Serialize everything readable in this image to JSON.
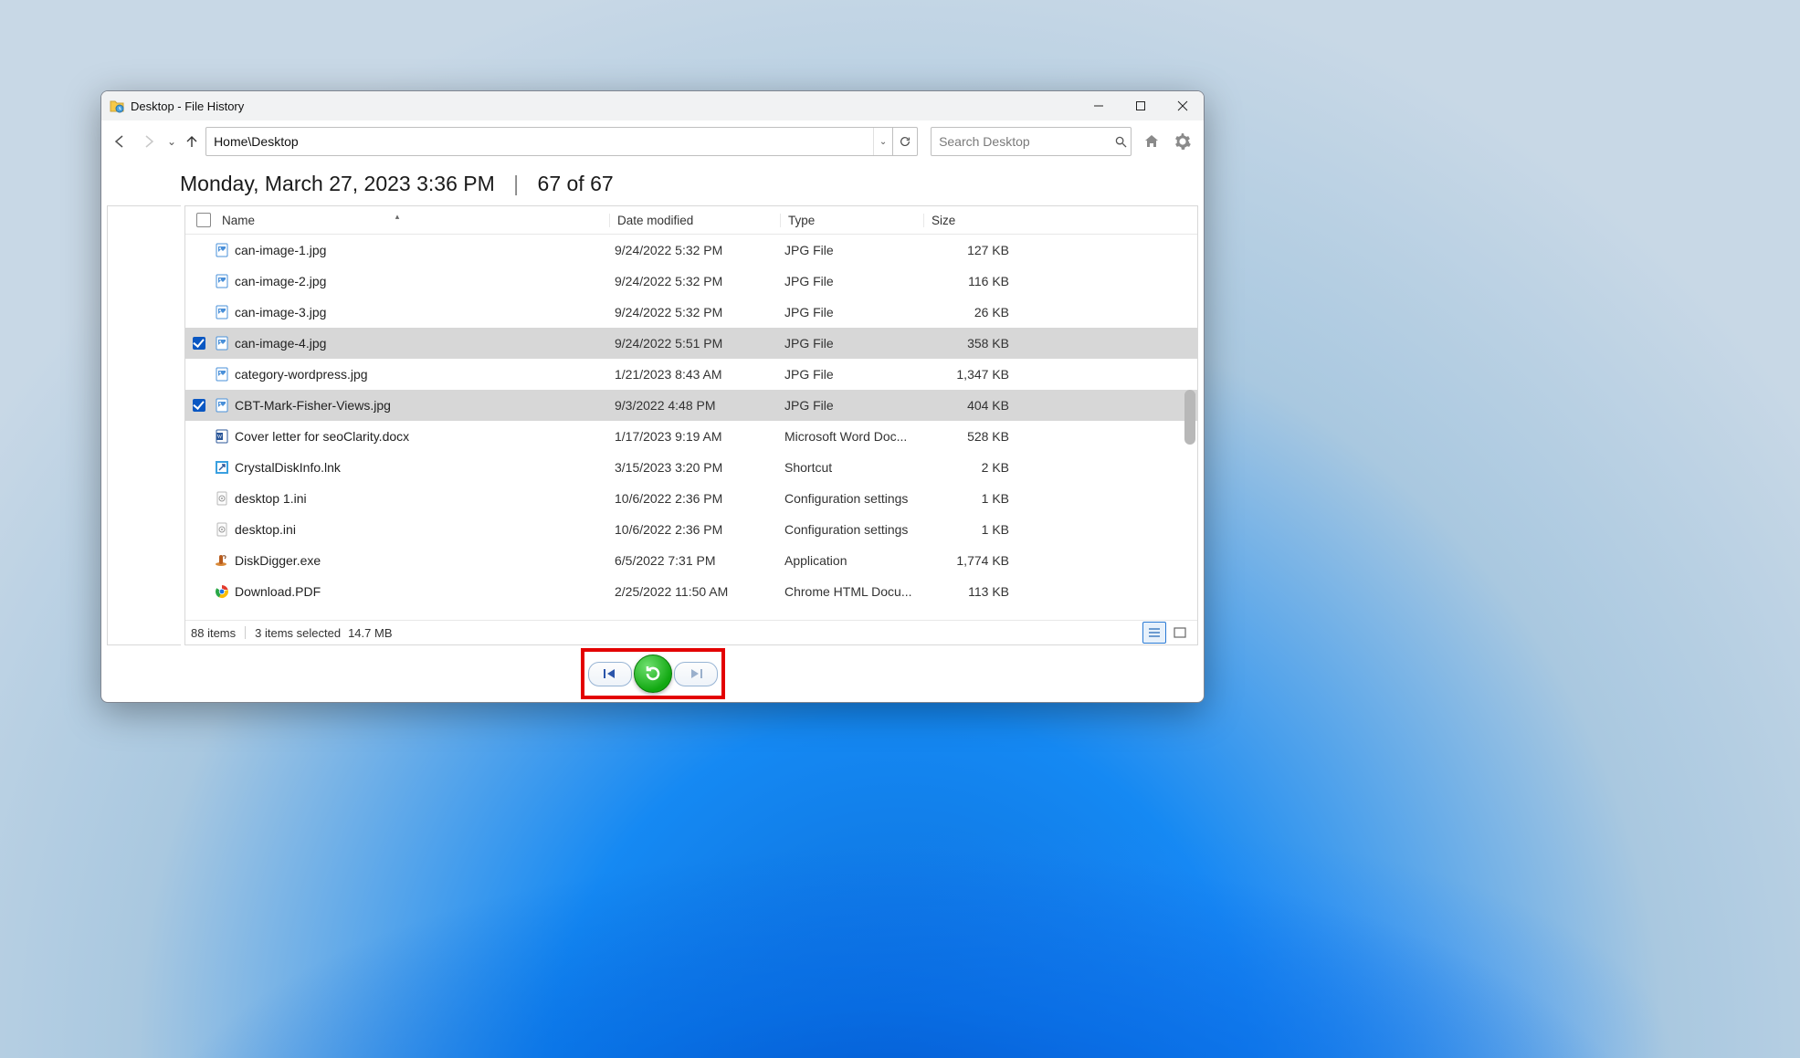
{
  "window": {
    "title": "Desktop - File History"
  },
  "toolbar": {
    "path": "Home\\Desktop",
    "search_placeholder": "Search Desktop"
  },
  "snapshot": {
    "timestamp": "Monday, March 27, 2023 3:36 PM",
    "position": "67 of 67"
  },
  "columns": {
    "name": "Name",
    "date": "Date modified",
    "type": "Type",
    "size": "Size"
  },
  "files": [
    {
      "selected": false,
      "icon": "jpg",
      "name": "can-image-1.jpg",
      "date": "9/24/2022 5:32 PM",
      "type": "JPG File",
      "size": "127 KB"
    },
    {
      "selected": false,
      "icon": "jpg",
      "name": "can-image-2.jpg",
      "date": "9/24/2022 5:32 PM",
      "type": "JPG File",
      "size": "116 KB"
    },
    {
      "selected": false,
      "icon": "jpg",
      "name": "can-image-3.jpg",
      "date": "9/24/2022 5:32 PM",
      "type": "JPG File",
      "size": "26 KB"
    },
    {
      "selected": true,
      "icon": "jpg",
      "name": "can-image-4.jpg",
      "date": "9/24/2022 5:51 PM",
      "type": "JPG File",
      "size": "358 KB"
    },
    {
      "selected": false,
      "icon": "jpg",
      "name": "category-wordpress.jpg",
      "date": "1/21/2023 8:43 AM",
      "type": "JPG File",
      "size": "1,347 KB"
    },
    {
      "selected": true,
      "icon": "jpg",
      "name": "CBT-Mark-Fisher-Views.jpg",
      "date": "9/3/2022 4:48 PM",
      "type": "JPG File",
      "size": "404 KB"
    },
    {
      "selected": false,
      "icon": "docx",
      "name": "Cover letter for seoClarity.docx",
      "date": "1/17/2023 9:19 AM",
      "type": "Microsoft Word Doc...",
      "size": "528 KB"
    },
    {
      "selected": false,
      "icon": "lnk",
      "name": "CrystalDiskInfo.lnk",
      "date": "3/15/2023 3:20 PM",
      "type": "Shortcut",
      "size": "2 KB"
    },
    {
      "selected": false,
      "icon": "ini",
      "name": "desktop 1.ini",
      "date": "10/6/2022 2:36 PM",
      "type": "Configuration settings",
      "size": "1 KB"
    },
    {
      "selected": false,
      "icon": "ini",
      "name": "desktop.ini",
      "date": "10/6/2022 2:36 PM",
      "type": "Configuration settings",
      "size": "1 KB"
    },
    {
      "selected": false,
      "icon": "exe",
      "name": "DiskDigger.exe",
      "date": "6/5/2022 7:31 PM",
      "type": "Application",
      "size": "1,774 KB"
    },
    {
      "selected": false,
      "icon": "chrome",
      "name": "Download.PDF",
      "date": "2/25/2022 11:50 AM",
      "type": "Chrome HTML Docu...",
      "size": "113 KB"
    }
  ],
  "status": {
    "items": "88 items",
    "selection": "3 items selected",
    "size": "14.7 MB"
  }
}
